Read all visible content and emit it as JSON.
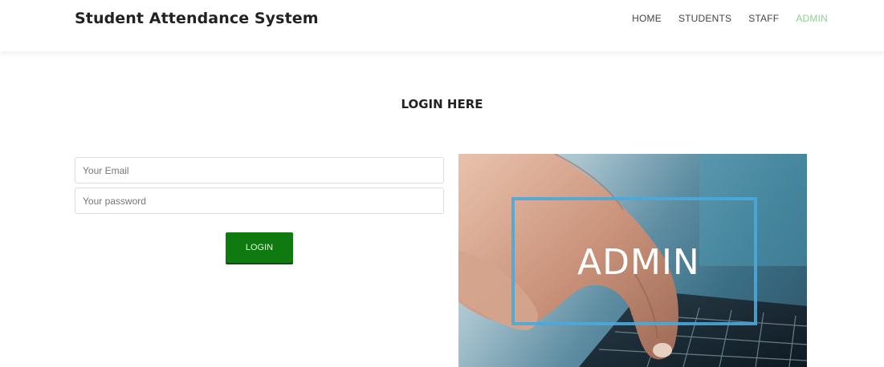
{
  "header": {
    "brand": "Student Attendance System",
    "nav": [
      {
        "label": "HOME",
        "active": false
      },
      {
        "label": "STUDENTS",
        "active": false
      },
      {
        "label": "STAFF",
        "active": false
      },
      {
        "label": "ADMIN",
        "active": true
      }
    ],
    "active_color": "#8fd08f"
  },
  "login": {
    "title": "LOGIN HERE",
    "email_placeholder": "Your Email",
    "email_value": "",
    "password_placeholder": "Your password",
    "password_value": "",
    "button_label": "LOGIN",
    "button_color": "#0f7a0f"
  },
  "hero": {
    "label": "ADMIN",
    "frame_color": "#4aa8dc",
    "icons": [
      "hand-typing-image",
      "laptop-keyboard-image"
    ]
  }
}
